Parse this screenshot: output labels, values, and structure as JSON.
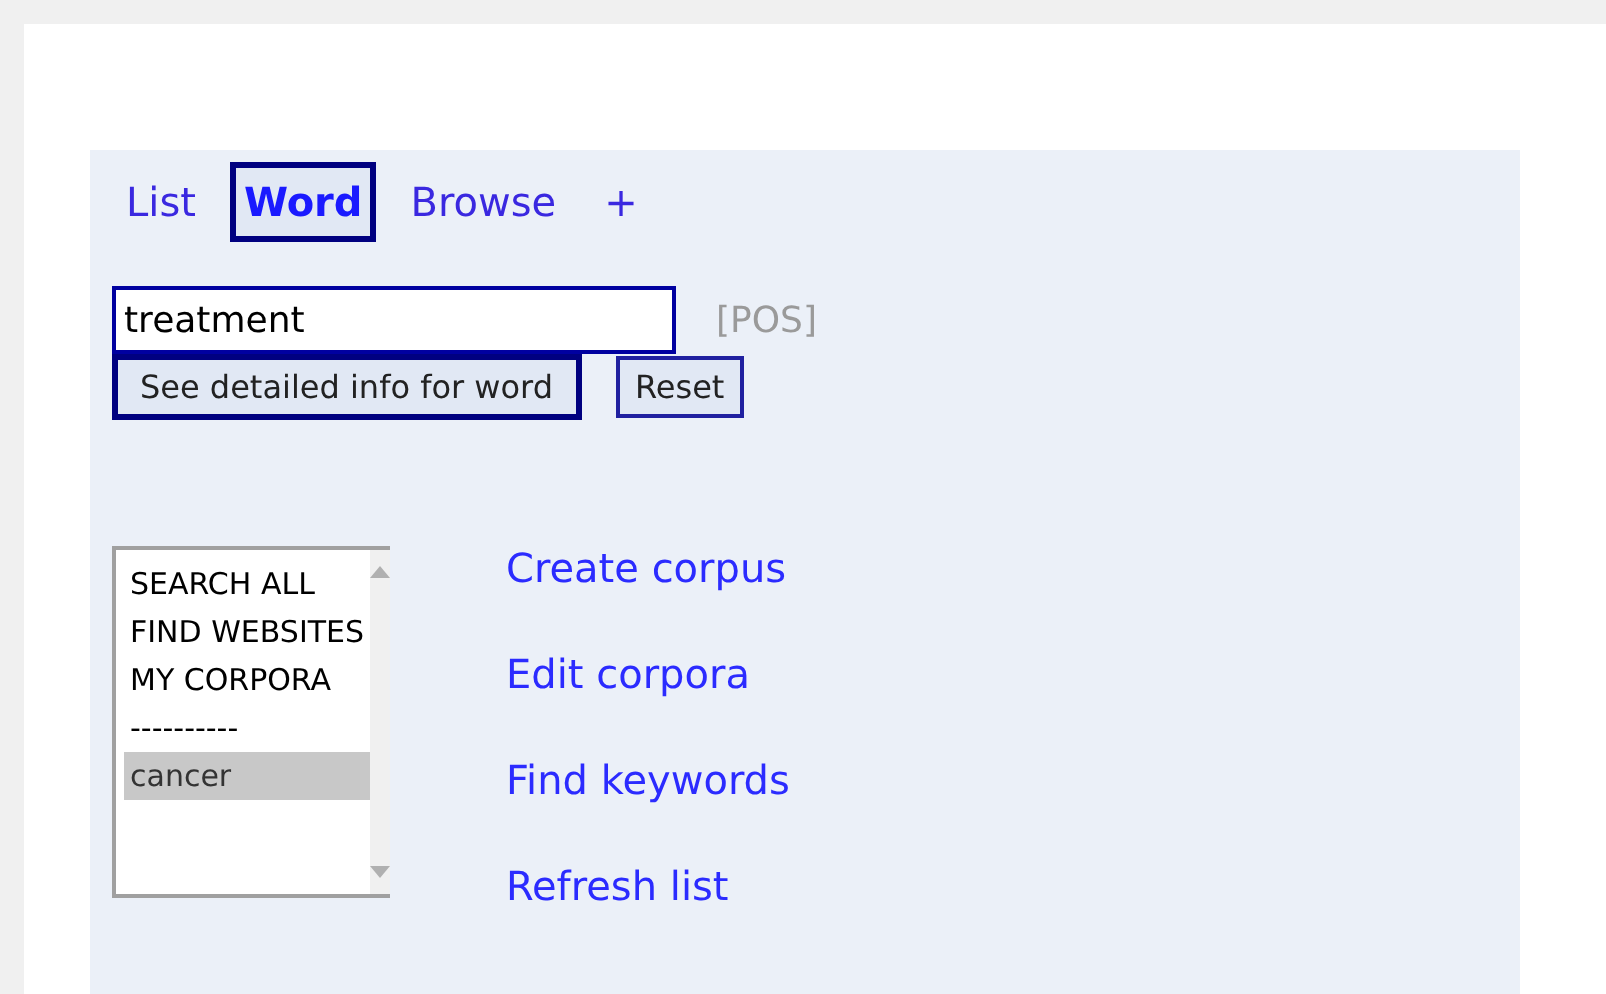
{
  "tabs": [
    {
      "label": "List",
      "selected": false
    },
    {
      "label": "Word",
      "selected": true
    },
    {
      "label": "Browse",
      "selected": false
    },
    {
      "label": "+",
      "selected": false
    }
  ],
  "search": {
    "value": "treatment",
    "pos_label": "[POS]"
  },
  "buttons": [
    "See detailed info for word",
    "Reset"
  ],
  "corpus_list": [
    {
      "label": "SEARCH ALL",
      "selected": false
    },
    {
      "label": "FIND WEBSITES",
      "selected": false
    },
    {
      "label": "MY CORPORA",
      "selected": false
    },
    {
      "label": "----------",
      "selected": false
    },
    {
      "label": "cancer",
      "selected": true
    }
  ],
  "links": [
    "Create corpus",
    "Edit corpora",
    "Find keywords",
    "Refresh list"
  ]
}
